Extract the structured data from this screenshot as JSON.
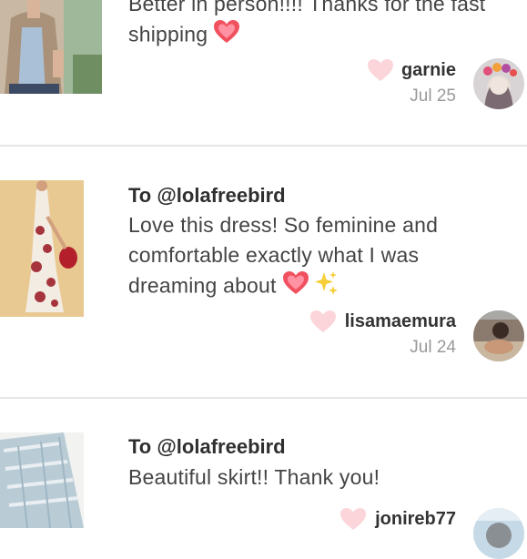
{
  "reviews": [
    {
      "body": "Better in person!!!! Thanks for the fast shipping",
      "reviewer": "garnie",
      "date": "Jul 25",
      "emojis": [
        "heart-emoji"
      ]
    },
    {
      "to": "To @lolafreebird",
      "body": "Love this dress! So feminine and comfortable exactly what I was dreaming about",
      "reviewer": "lisamaemura",
      "date": "Jul 24",
      "emojis": [
        "heart-emoji",
        "sparkles-emoji"
      ]
    },
    {
      "to": "To @lolafreebird",
      "body": "Beautiful skirt!! Thank you!",
      "reviewer": "jonireb77",
      "date": "",
      "emojis": []
    }
  ],
  "colors": {
    "heart_like": "#fcd5da",
    "divider": "#e6e6e6",
    "date_gray": "#999999"
  },
  "icons": [
    "like-heart-icon",
    "heart-emoji",
    "sparkles-emoji",
    "avatar"
  ]
}
